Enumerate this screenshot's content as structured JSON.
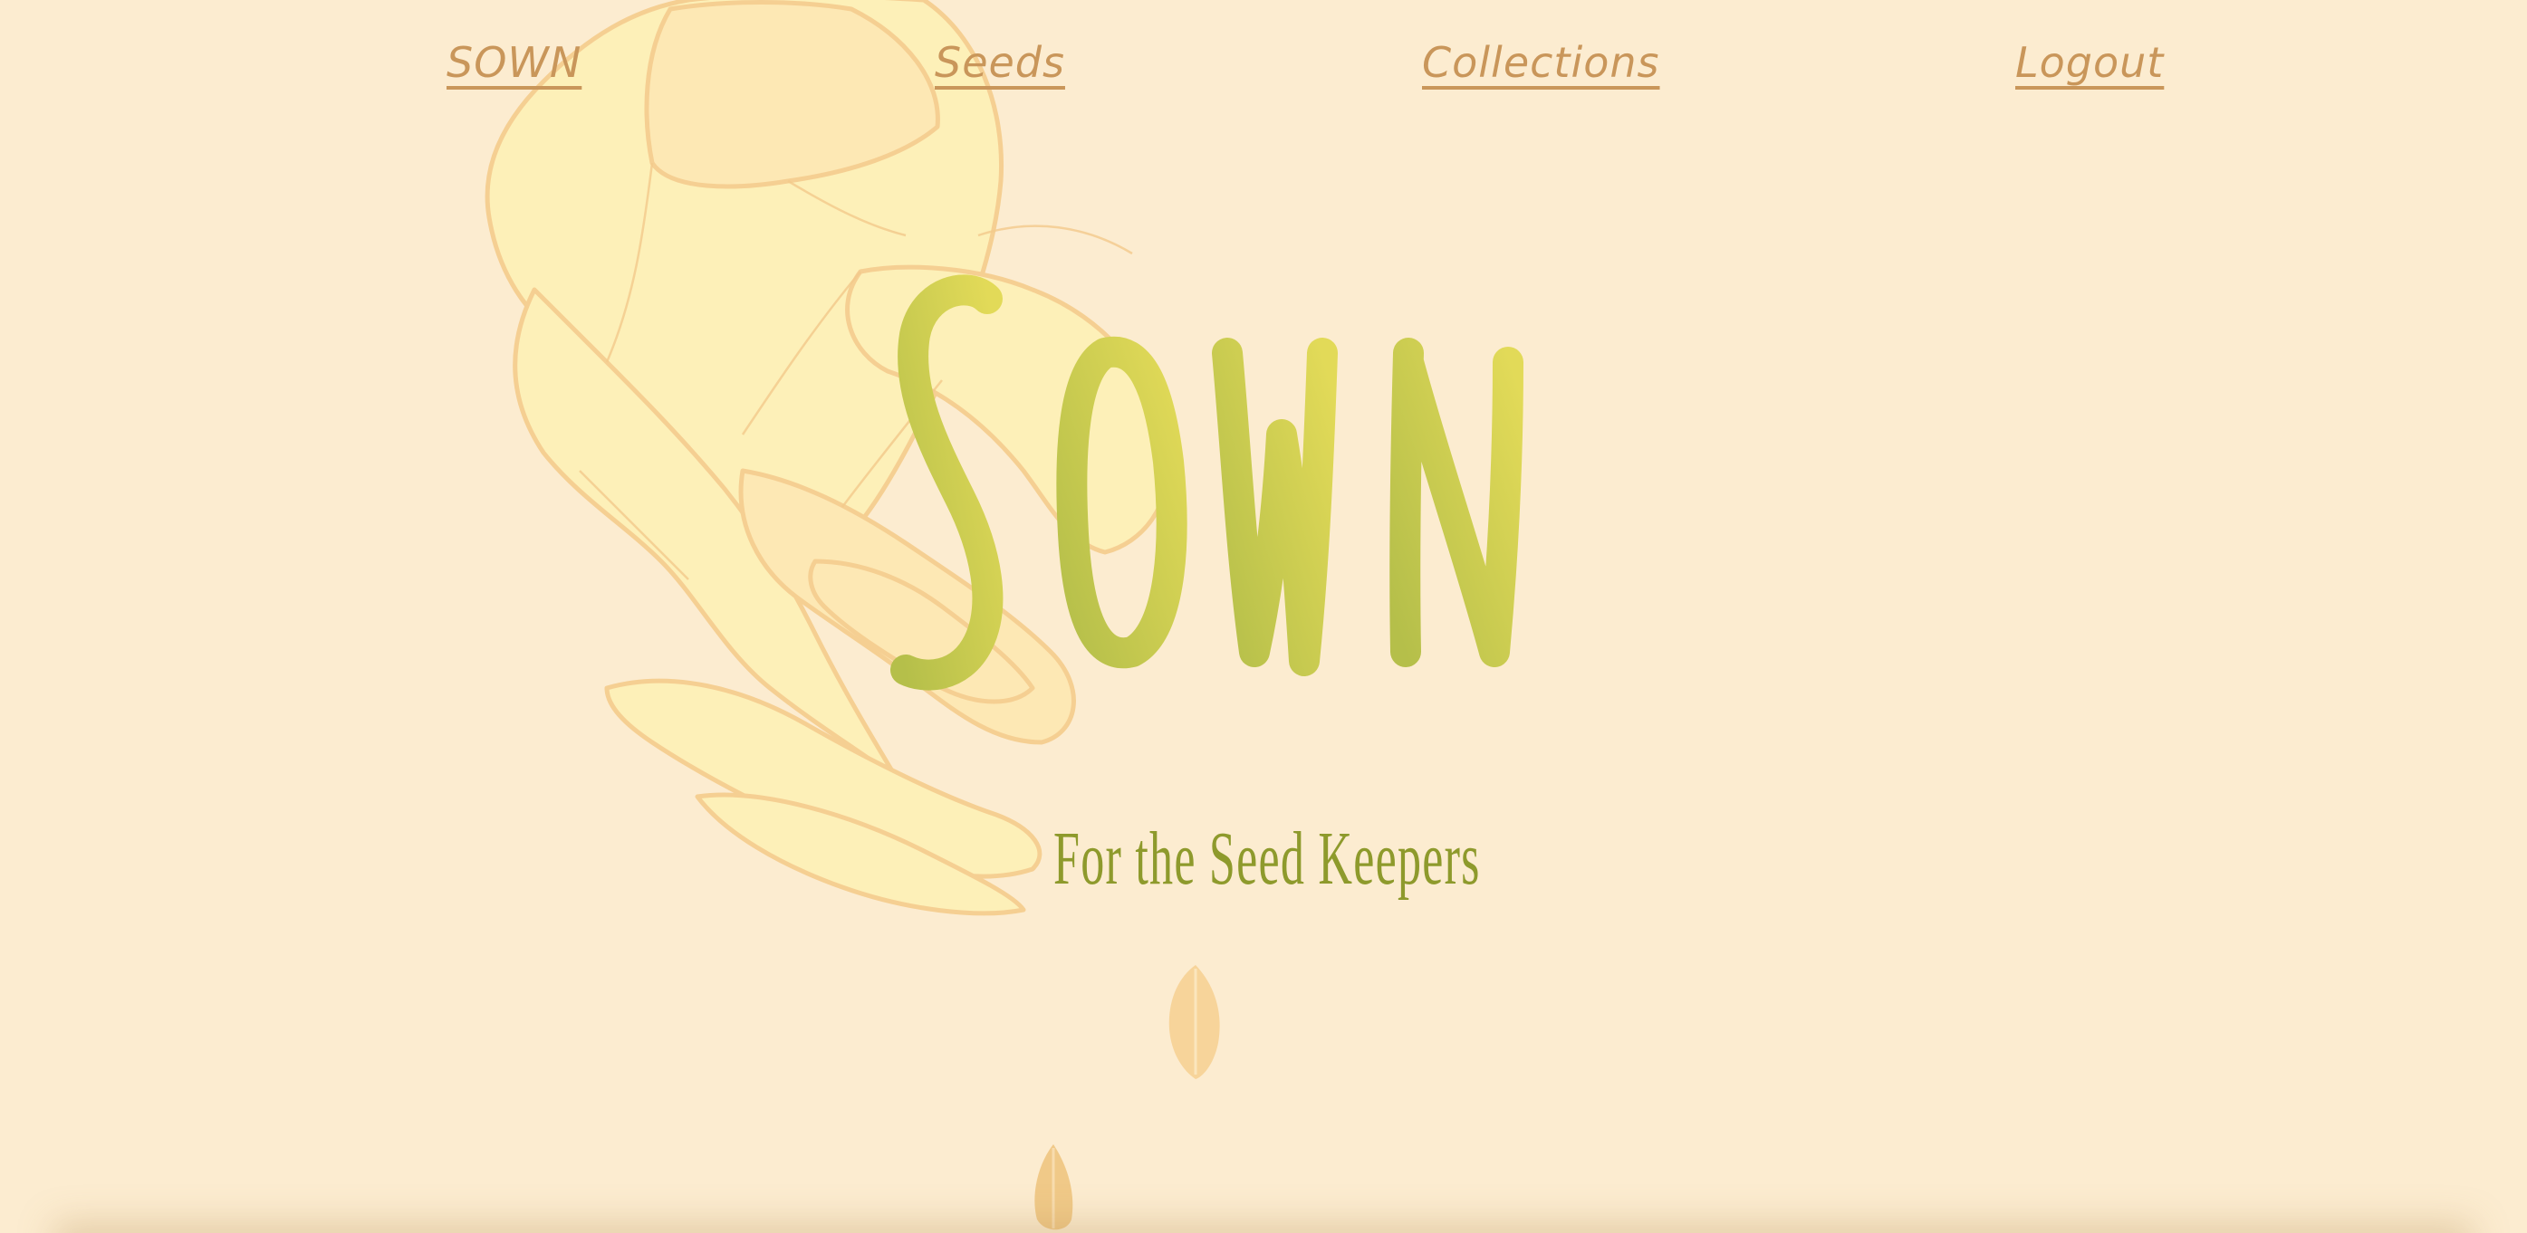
{
  "nav": {
    "home_label": "SOWN",
    "seeds_label": "Seeds",
    "collections_label": "Collections",
    "logout_label": "Logout"
  },
  "hero": {
    "title": "SOWN",
    "tagline": "For the Seed Keepers"
  },
  "colors": {
    "background": "#fcecd0",
    "nav_link": "#c9965a",
    "title_green_start": "#b5bf4a",
    "title_green_end": "#e2da58",
    "tagline": "#8e9a2c",
    "hand_fill": "#fdf0b8",
    "hand_stroke": "#f5cf92",
    "seed": "#f7d49a"
  },
  "icons": {
    "hand": "hand-sowing-illustration",
    "seed": "seed-icon"
  }
}
